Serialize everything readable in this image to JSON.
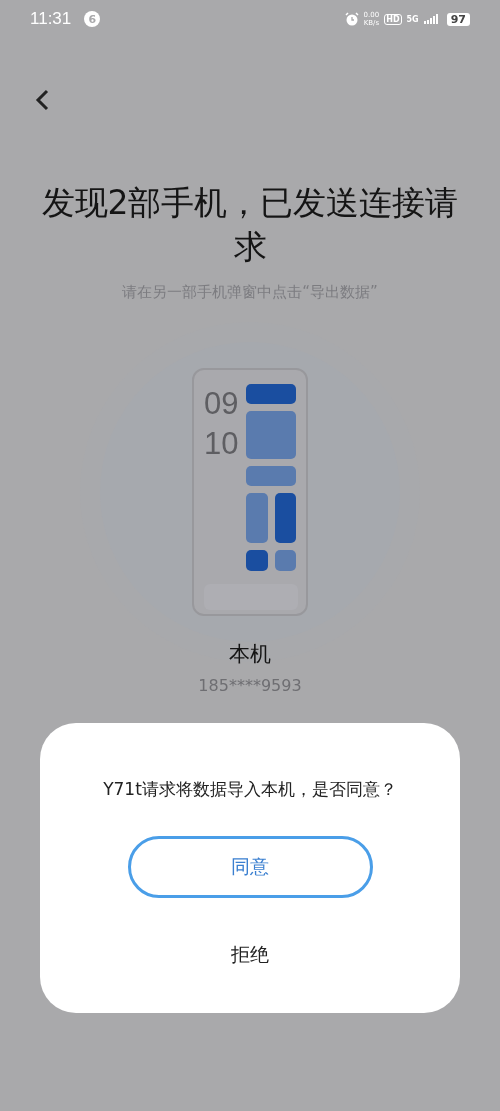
{
  "status_bar": {
    "time": "11:31",
    "notification_count": "6",
    "speed_value": "0.00",
    "speed_unit": "KB/s",
    "hd": "HD",
    "network": "5G",
    "battery": "97"
  },
  "title": "发现2部手机，已发送连接请求",
  "subtitle": "请在另一部手机弹窗中点击“导出数据”",
  "device": {
    "clock_hour": "09",
    "clock_minute": "10",
    "name": "本机",
    "number": "185****9593"
  },
  "dialog": {
    "message": "Y71t请求将数据导入本机，是否同意？",
    "buttons": [
      {
        "label": "同意",
        "kind": "primary"
      },
      {
        "label": "拒绝",
        "kind": "text"
      }
    ]
  }
}
